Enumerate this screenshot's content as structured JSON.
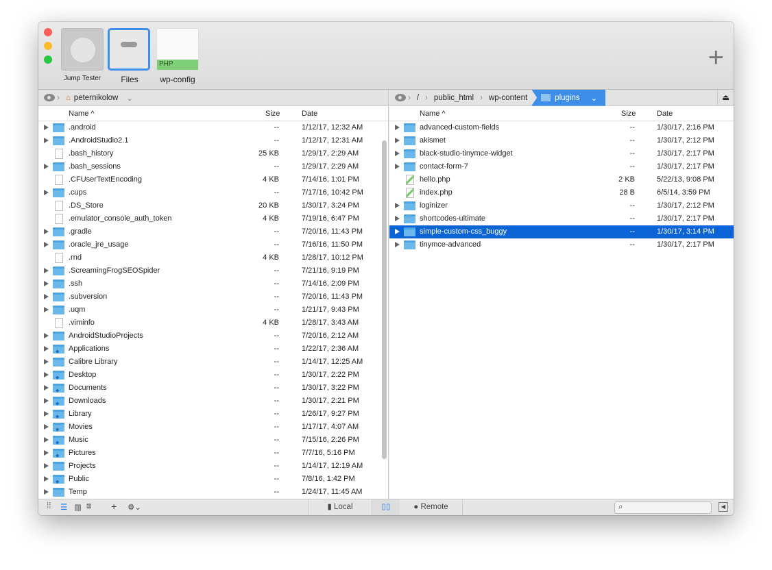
{
  "tabs": [
    {
      "label": "Jump Tester"
    },
    {
      "label": "Files"
    },
    {
      "label": "wp-config",
      "badge": "PHP"
    }
  ],
  "left": {
    "path": [
      "peternikolow"
    ],
    "columns": {
      "name": "Name ^",
      "size": "Size",
      "date": "Date"
    },
    "rows": [
      [
        "folder",
        ".android",
        "--",
        "1/12/17, 12:32 AM"
      ],
      [
        "folder",
        ".AndroidStudio2.1",
        "--",
        "1/12/17, 12:31 AM"
      ],
      [
        "file",
        ".bash_history",
        "25 KB",
        "1/29/17, 2:29 AM"
      ],
      [
        "folder",
        ".bash_sessions",
        "--",
        "1/29/17, 2:29 AM"
      ],
      [
        "file",
        ".CFUserTextEncoding",
        "4 KB",
        "7/14/16, 1:01 PM"
      ],
      [
        "folder",
        ".cups",
        "--",
        "7/17/16, 10:42 PM"
      ],
      [
        "file",
        ".DS_Store",
        "20 KB",
        "1/30/17, 3:24 PM"
      ],
      [
        "file",
        ".emulator_console_auth_token",
        "4 KB",
        "7/19/16, 6:47 PM"
      ],
      [
        "folder",
        ".gradle",
        "--",
        "7/20/16, 11:43 PM"
      ],
      [
        "folder",
        ".oracle_jre_usage",
        "--",
        "7/16/16, 11:50 PM"
      ],
      [
        "file",
        ".rnd",
        "4 KB",
        "1/28/17, 10:12 PM"
      ],
      [
        "folder",
        ".ScreamingFrogSEOSpider",
        "--",
        "7/21/16, 9:19 PM"
      ],
      [
        "folder",
        ".ssh",
        "--",
        "7/14/16, 2:09 PM"
      ],
      [
        "folder",
        ".subversion",
        "--",
        "7/20/16, 11:43 PM"
      ],
      [
        "folder",
        ".uqm",
        "--",
        "1/21/17, 9:43 PM"
      ],
      [
        "file",
        ".viminfo",
        "4 KB",
        "1/28/17, 3:43 AM"
      ],
      [
        "folder",
        "AndroidStudioProjects",
        "--",
        "7/20/16, 2:12 AM"
      ],
      [
        "special",
        "Applications",
        "--",
        "1/22/17, 2:36 AM"
      ],
      [
        "folder",
        "Calibre Library",
        "--",
        "1/14/17, 12:25 AM"
      ],
      [
        "special",
        "Desktop",
        "--",
        "1/30/17, 2:22 PM"
      ],
      [
        "special",
        "Documents",
        "--",
        "1/30/17, 3:22 PM"
      ],
      [
        "special",
        "Downloads",
        "--",
        "1/30/17, 2:21 PM"
      ],
      [
        "special",
        "Library",
        "--",
        "1/26/17, 9:27 PM"
      ],
      [
        "special",
        "Movies",
        "--",
        "1/17/17, 4:07 AM"
      ],
      [
        "special",
        "Music",
        "--",
        "7/15/16, 2:26 PM"
      ],
      [
        "special",
        "Pictures",
        "--",
        "7/7/16, 5:16 PM"
      ],
      [
        "folder",
        "Projects",
        "--",
        "1/14/17, 12:19 AM"
      ],
      [
        "special",
        "Public",
        "--",
        "7/8/16, 1:42 PM"
      ],
      [
        "folder",
        "Temp",
        "--",
        "1/24/17, 11:45 AM"
      ]
    ]
  },
  "right": {
    "path": [
      "/",
      "public_html",
      "wp-content",
      "plugins"
    ],
    "columns": {
      "name": "Name ^",
      "size": "Size",
      "date": "Date"
    },
    "selected": "simple-custom-css_buggy",
    "rows": [
      [
        "folder",
        "advanced-custom-fields",
        "--",
        "1/30/17, 2:16 PM"
      ],
      [
        "folder",
        "akismet",
        "--",
        "1/30/17, 2:12 PM"
      ],
      [
        "folder",
        "black-studio-tinymce-widget",
        "--",
        "1/30/17, 2:17 PM"
      ],
      [
        "folder",
        "contact-form-7",
        "--",
        "1/30/17, 2:17 PM"
      ],
      [
        "php",
        "hello.php",
        "2 KB",
        "5/22/13, 9:08 PM"
      ],
      [
        "php",
        "index.php",
        "28 B",
        "6/5/14, 3:59 PM"
      ],
      [
        "folder",
        "loginizer",
        "--",
        "1/30/17, 2:12 PM"
      ],
      [
        "folder",
        "shortcodes-ultimate",
        "--",
        "1/30/17, 2:17 PM"
      ],
      [
        "folder",
        "simple-custom-css_buggy",
        "--",
        "1/30/17, 3:14 PM"
      ],
      [
        "folder",
        "tinymce-advanced",
        "--",
        "1/30/17, 2:17 PM"
      ]
    ]
  },
  "bottom": {
    "local": "Local",
    "remote": "Remote",
    "search_placeholder": ""
  },
  "colors": {
    "accent": "#0b63d5",
    "crumb": "#3d8ee8",
    "folder": "#6ab8ec"
  }
}
